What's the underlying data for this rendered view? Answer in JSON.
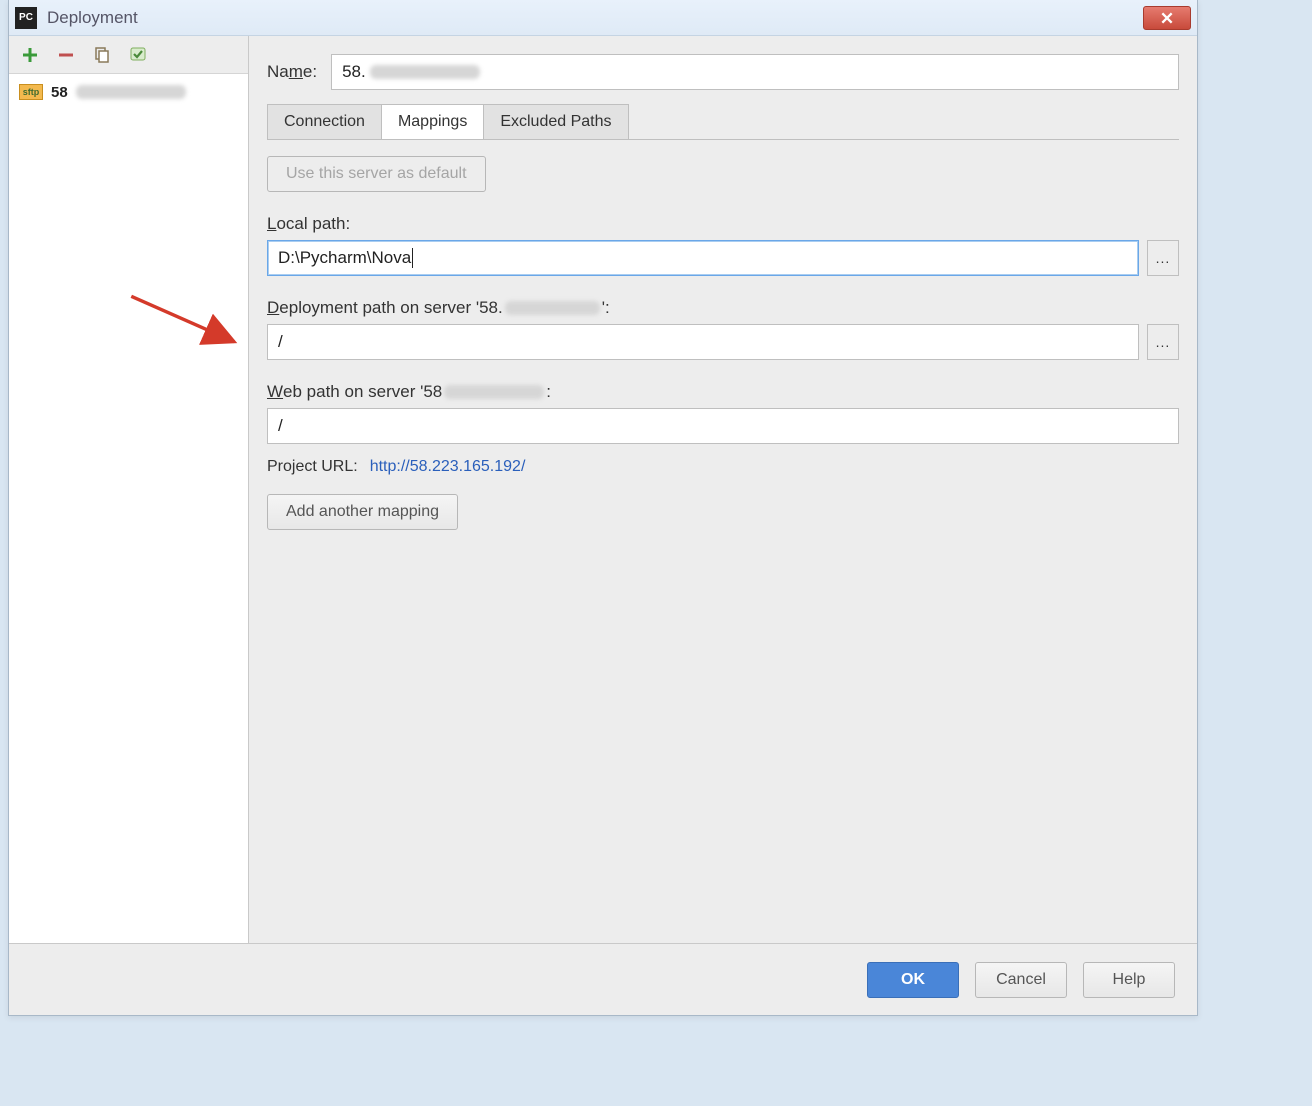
{
  "window": {
    "title": "Deployment",
    "app_badge": "PC"
  },
  "sidebar": {
    "toolbar": {
      "add": "plus-icon",
      "remove": "minus-icon",
      "copy": "copy-icon",
      "check": "check-icon"
    },
    "items": [
      {
        "protocol_badge": "sftp",
        "name_visible": "58",
        "obscured": true
      }
    ]
  },
  "form": {
    "name_label": "Name:",
    "name_value_visible": "58.",
    "name_obscured": true
  },
  "tabs": [
    {
      "id": "connection",
      "label": "Connection",
      "active": false
    },
    {
      "id": "mappings",
      "label": "Mappings",
      "active": true
    },
    {
      "id": "excluded",
      "label": "Excluded Paths",
      "active": false
    }
  ],
  "mappings": {
    "use_default_button": "Use this server as default",
    "use_default_enabled": false,
    "local_path_label": "Local path:",
    "local_path_underline_char": "L",
    "local_path_value": "D:\\Pycharm\\Nova",
    "deploy_path_label_prefix": "Deployment path on server '58.",
    "deploy_path_label_suffix": "':",
    "deploy_path_underline_char": "D",
    "deploy_path_obscured": true,
    "deploy_path_value": "/",
    "web_path_label_prefix": "Web path on server '58",
    "web_path_label_suffix": "':",
    "web_path_underline_char": "W",
    "web_path_obscured": true,
    "web_path_value": "/",
    "project_url_label": "Project URL:",
    "project_url": "http://58.223.165.192/",
    "add_mapping_button": "Add another mapping",
    "browse_button": "..."
  },
  "footer": {
    "ok": "OK",
    "cancel": "Cancel",
    "help": "Help"
  },
  "annotations": {
    "arrow": "red-arrow"
  }
}
